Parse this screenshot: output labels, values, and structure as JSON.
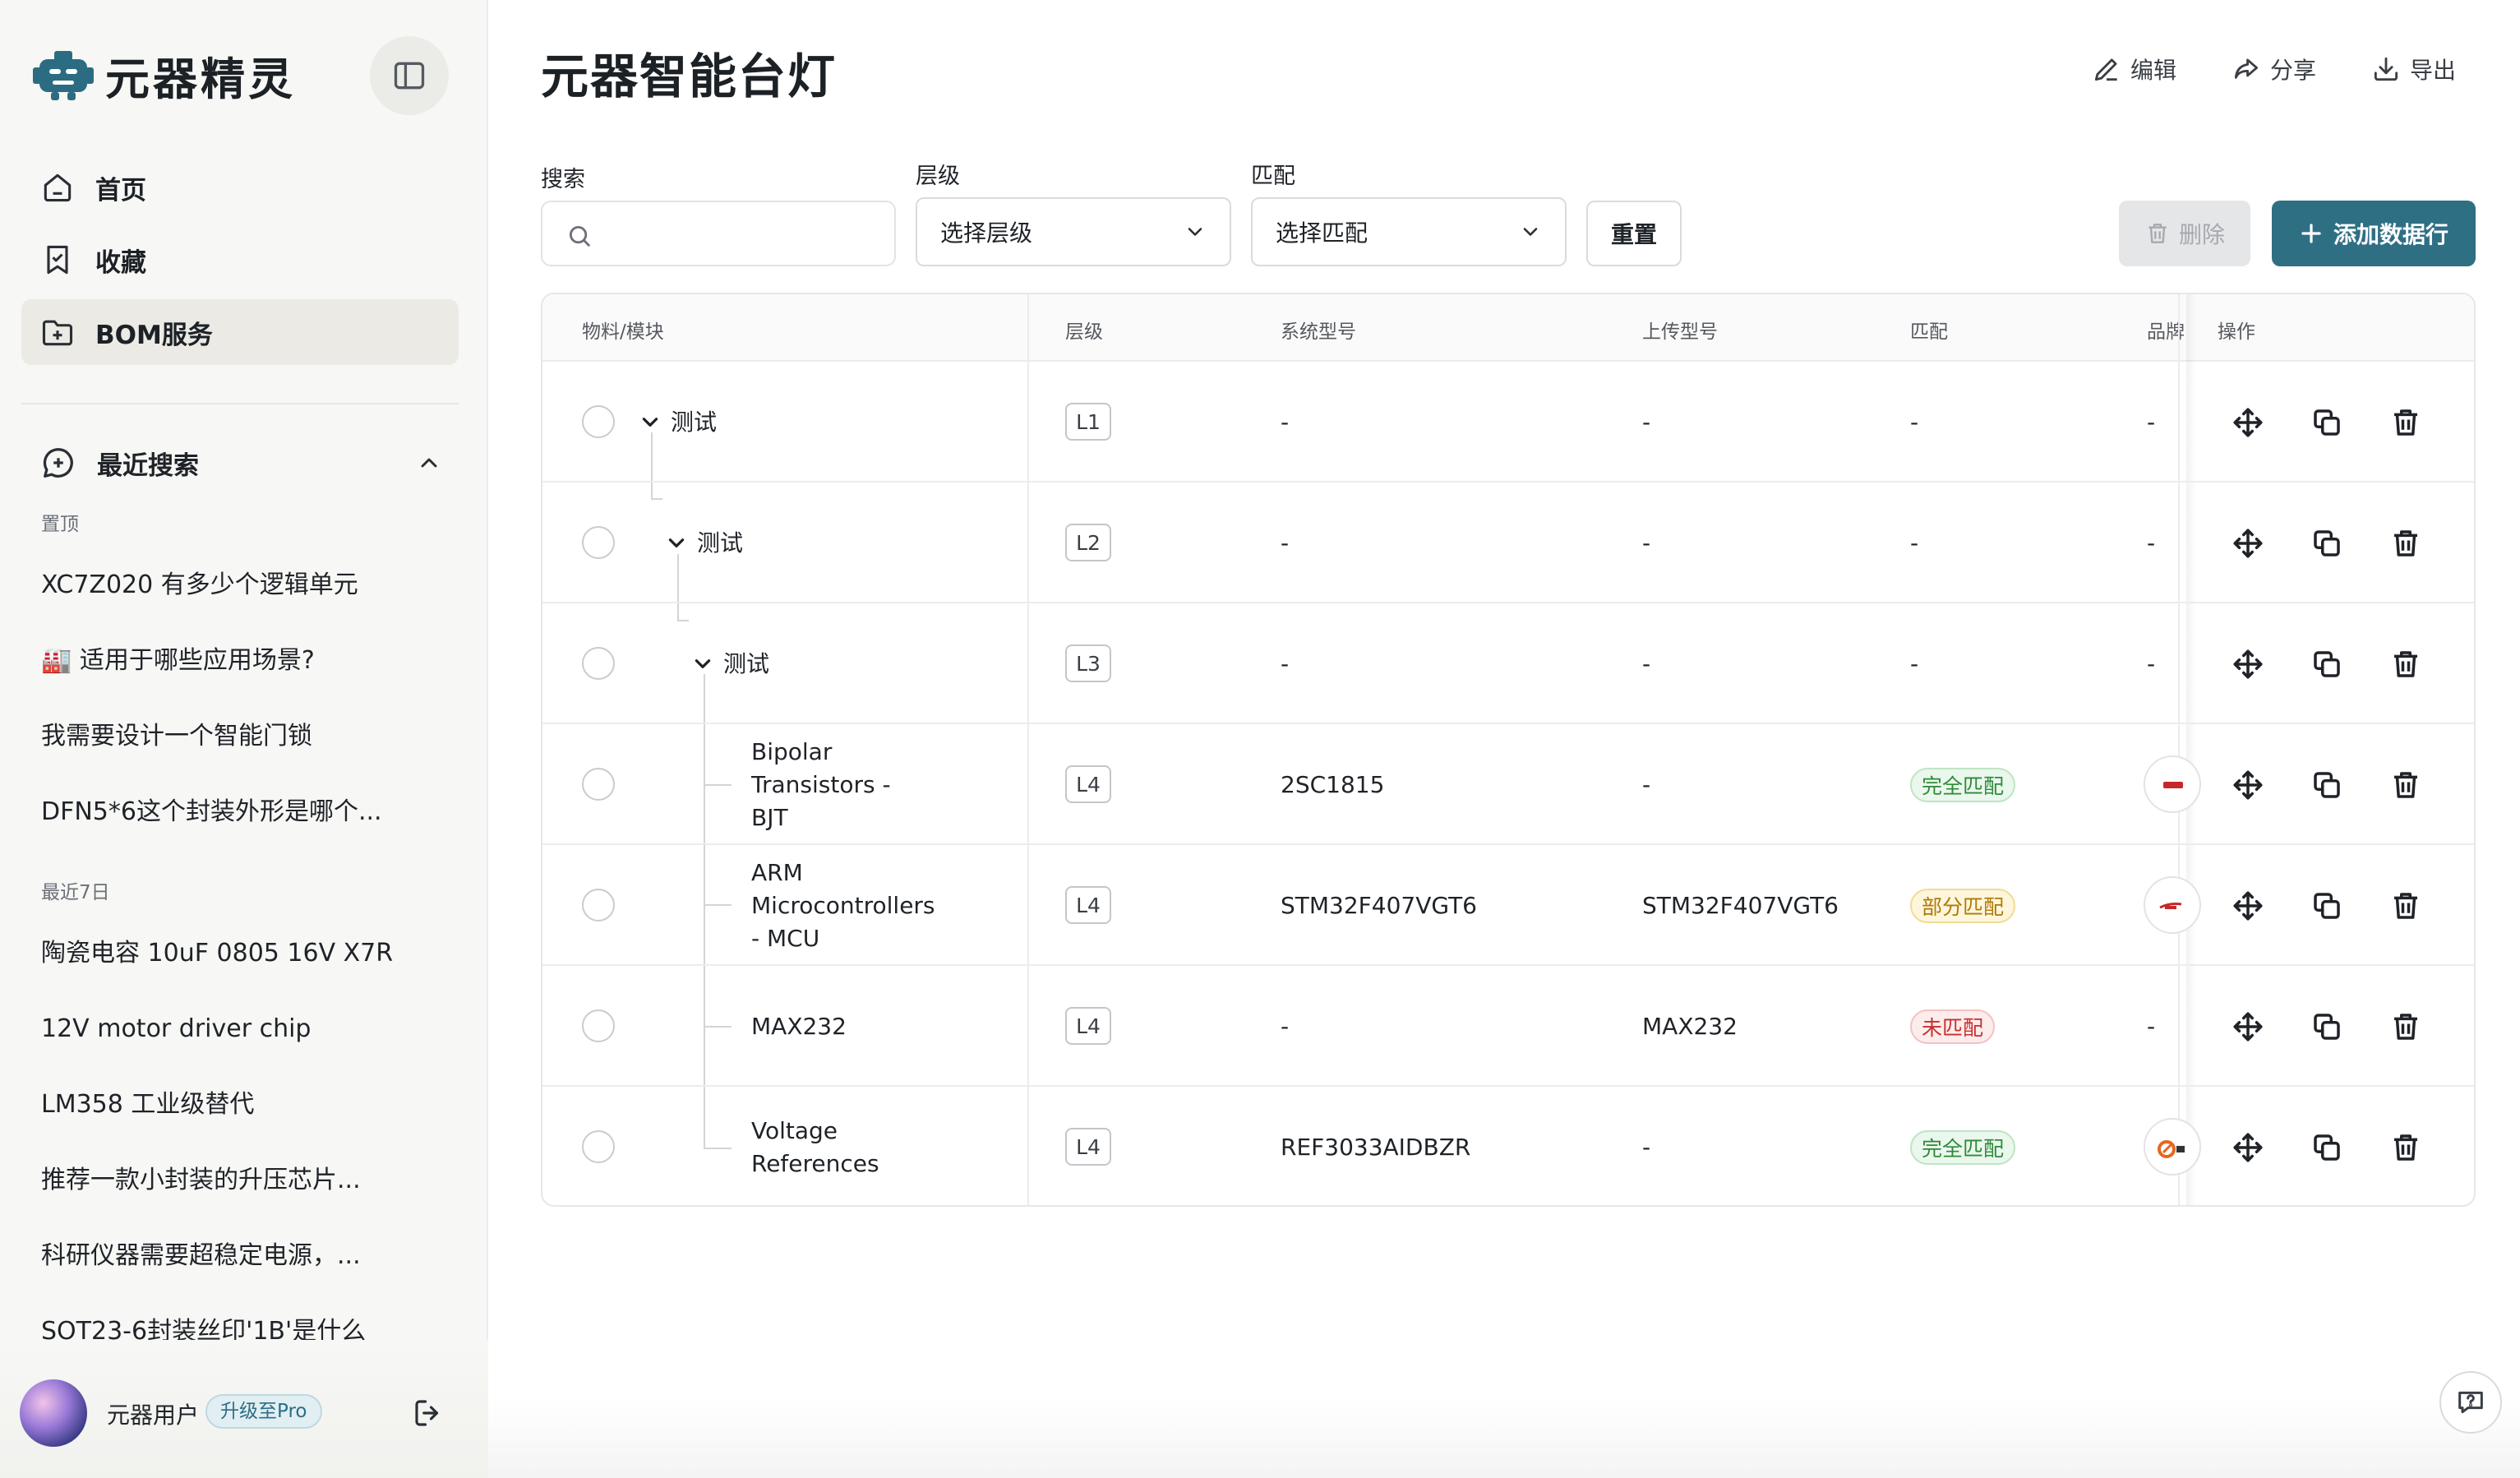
{
  "app": {
    "name": "元器精灵"
  },
  "nav": {
    "items": [
      {
        "label": "首页"
      },
      {
        "label": "收藏"
      },
      {
        "label": "BOM服务"
      }
    ]
  },
  "recent": {
    "title": "最近搜索",
    "pinned_label": "置顶",
    "pinned": [
      "XC7Z020 有多少个逻辑单元",
      "🏭 适用于哪些应用场景?",
      "我需要设计一个智能门锁",
      "DFN5*6这个封装外形是哪个..."
    ],
    "week_label": "最近7日",
    "week": [
      "陶瓷电容 10uF 0805 16V X7R",
      "12V motor driver chip",
      "LM358 工业级替代",
      "推荐一款小封装的升压芯片...",
      "科研仪器需要超稳定电源，...",
      "SOT23-6封装丝印'1B'是什么"
    ]
  },
  "user": {
    "name": "元器用户",
    "upgrade_label": "升级至Pro"
  },
  "page": {
    "title": "元器智能台灯"
  },
  "top_actions": {
    "edit": "编辑",
    "share": "分享",
    "export": "导出"
  },
  "filters": {
    "search_label": "搜索",
    "search_placeholder": "",
    "level_label": "层级",
    "level_value": "选择层级",
    "match_label": "匹配",
    "match_value": "选择匹配",
    "reset": "重置",
    "delete": "删除",
    "add": "添加数据行"
  },
  "table": {
    "headers": {
      "material": "物料/模块",
      "level": "层级",
      "sys_model": "系统型号",
      "upload_model": "上传型号",
      "match": "匹配",
      "brand": "品牌",
      "actions": "操作"
    },
    "rows": [
      {
        "name": "测试",
        "level": "L1",
        "sys_model": "-",
        "upload_model": "-",
        "match": "-",
        "brand": "-"
      },
      {
        "name": "测试",
        "level": "L2",
        "sys_model": "-",
        "upload_model": "-",
        "match": "-",
        "brand": "-"
      },
      {
        "name": "测试",
        "level": "L3",
        "sys_model": "-",
        "upload_model": "-",
        "match": "-",
        "brand": "-"
      },
      {
        "name": "Bipolar Transistors - BJT",
        "level": "L4",
        "sys_model": "2SC1815",
        "upload_model": "-",
        "match": "完全匹配",
        "brand": ""
      },
      {
        "name": "ARM Microcontrollers - MCU",
        "level": "L4",
        "sys_model": "STM32F407VGT6",
        "upload_model": "STM32F407VGT6",
        "match": "部分匹配",
        "brand": ""
      },
      {
        "name": "MAX232",
        "level": "L4",
        "sys_model": "-",
        "upload_model": "MAX232",
        "match": "未匹配",
        "brand": "-"
      },
      {
        "name": "Voltage References",
        "level": "L4",
        "sys_model": "REF3033AIDBZR",
        "upload_model": "-",
        "match": "完全匹配",
        "brand": ""
      }
    ]
  }
}
